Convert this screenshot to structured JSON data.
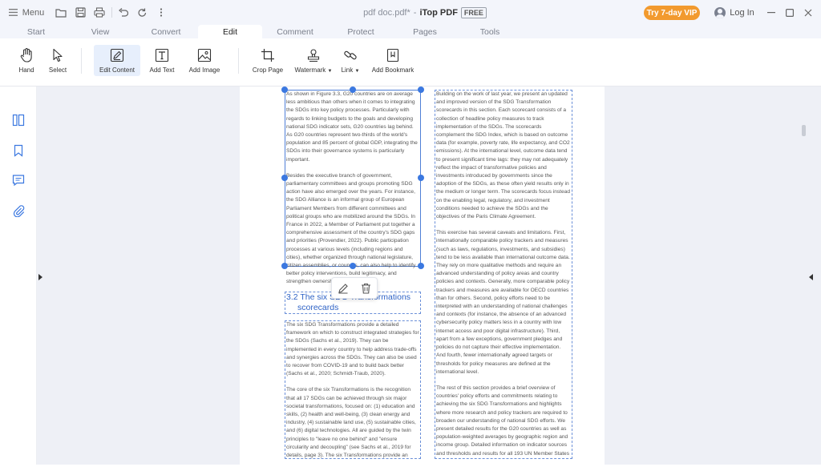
{
  "titlebar": {
    "menu_label": "Menu",
    "doc_name": "pdf doc.pdf*",
    "separator": "-",
    "app_name": "iTop PDF",
    "free_badge": "FREE",
    "vip_button": "Try 7-day VIP",
    "login_label": "Log In"
  },
  "tabs": [
    "Start",
    "View",
    "Convert",
    "Edit",
    "Comment",
    "Protect",
    "Pages",
    "Tools"
  ],
  "active_tab": "Edit",
  "toolbar": {
    "hand": "Hand",
    "select": "Select",
    "edit_content": "Edit Content",
    "add_text": "Add Text",
    "add_image": "Add Image",
    "crop_page": "Crop Page",
    "watermark": "Watermark",
    "link": "Link",
    "add_bookmark": "Add Bookmark"
  },
  "sidebar": [
    "thumbnails-icon",
    "bookmark-icon",
    "comment-icon",
    "attachment-icon"
  ],
  "document": {
    "left_col": {
      "selected_block": [
        "As shown in Figure 3.3, G20 countries are on average less ambitious than others when it comes to integrating the SDGs into key policy processes. Particularly with regards to linking budgets to the goals and developing national SDG indicator sets, G20 countries lag behind. As G20 countries represent two-thirds of the world's population and 85 percent of global GDP, integrating the SDGs into their governance systems is particularly important.",
        "Besides the executive branch of government, parliamentary committees and groups promoting SDG action have also emerged over the years. For instance, the SDG Alliance is an informal group of European Parliament Members from different committees and political groups who are mobilized around the SDGs. In France in 2022, a Member of Parliament put together a comprehensive assessment of the country's SDG gaps and priorities (Provendier, 2022). Public participation processes at various levels (including regions and cities), whether organized through national legislature, citizen assemblies, or councils, can also help to identify better policy interventions, build legitimacy, and strengthen ownership of SDG actions."
      ],
      "heading_line1": "3.2 The six SDG Transformations",
      "heading_line2": "scorecards",
      "lower_block": [
        "The six SDG Transformations provide a detailed framework on which to construct integrated strategies for the SDGs (Sachs et al., 2019). They can be implemented in every country to help address trade-offs and synergies across the SDGs. They can also be used to recover from COVID-19 and to build back better (Sachs et al., 2020; Schmidt-Traub, 2020).",
        "The core of the six Transformations is the recognition that all 17 SDGs can be achieved through six major societal transformations, focused on: (1) education and skills, (2) health and well-being, (3) clean energy and industry, (4) sustainable land use, (5) sustainable cities, and (6) digital technologies. All are guided by the twin principles to \"leave no one behind\" and \"ensure circularity and decoupling\" (see Sachs et al., 2019 for details, page 3). The six Transformations provide an action agenda for government ministries, businesses, and civil society."
      ]
    },
    "right_col": {
      "block": [
        "Building on the work of last year, we present an updated and improved version of the SDG Transformation scorecards in this section. Each scorecard consists of a collection of headline policy measures to track implementation of the SDGs. The scorecards complement the SDG Index, which is based on outcome data (for example, poverty rate, life expectancy, and CO2 emissions). At the international level, outcome data tend to present significant time lags: they may not adequately reflect the impact of transformative policies and investments introduced by governments since the adoption of the SDGs, as these often yield results only in the medium or longer term. The scorecards focus instead on the enabling legal, regulatory, and investment conditions needed to achieve the SDGs and the objectives of the Paris Climate Agreement.",
        "This exercise has several caveats and limitations. First, internationally comparable policy trackers and measures (such as laws, regulations, investments, and subsidies) tend to be less available than international outcome data. They rely on more qualitative methods and require an advanced understanding of policy areas and country policies and contexts. Generally, more comparable policy trackers and measures are available for OECD countries than for others. Second, policy efforts need to be interpreted with an understanding of national challenges and contexts (for instance, the absence of an advanced cybersecurity policy matters less in a country with low internet access and poor digital infrastructure). Third, apart from a few exceptions, government pledges and policies do not capture their effective implementation. And fourth, fewer internationally agreed targets or thresholds for policy measures are defined at the international level.",
        "The rest of this section provides a brief overview of countries' policy efforts and commitments relating to achieving the six SDG Transformations and highlights where more research and policy trackers are required to broaden our understanding of national SDG efforts. We present detailed results for the G20 countries as well as population-weighted averages by geographic region and income group. Detailed information on indicator sources and thresholds and results for all 193 UN Member States are accessible online at www.sdgindex.org."
      ]
    }
  },
  "colors": {
    "accent": "#3b78e0",
    "vip": "#f29a2e",
    "heading": "#2f63c6",
    "active_tool_bg": "#e7effc"
  }
}
